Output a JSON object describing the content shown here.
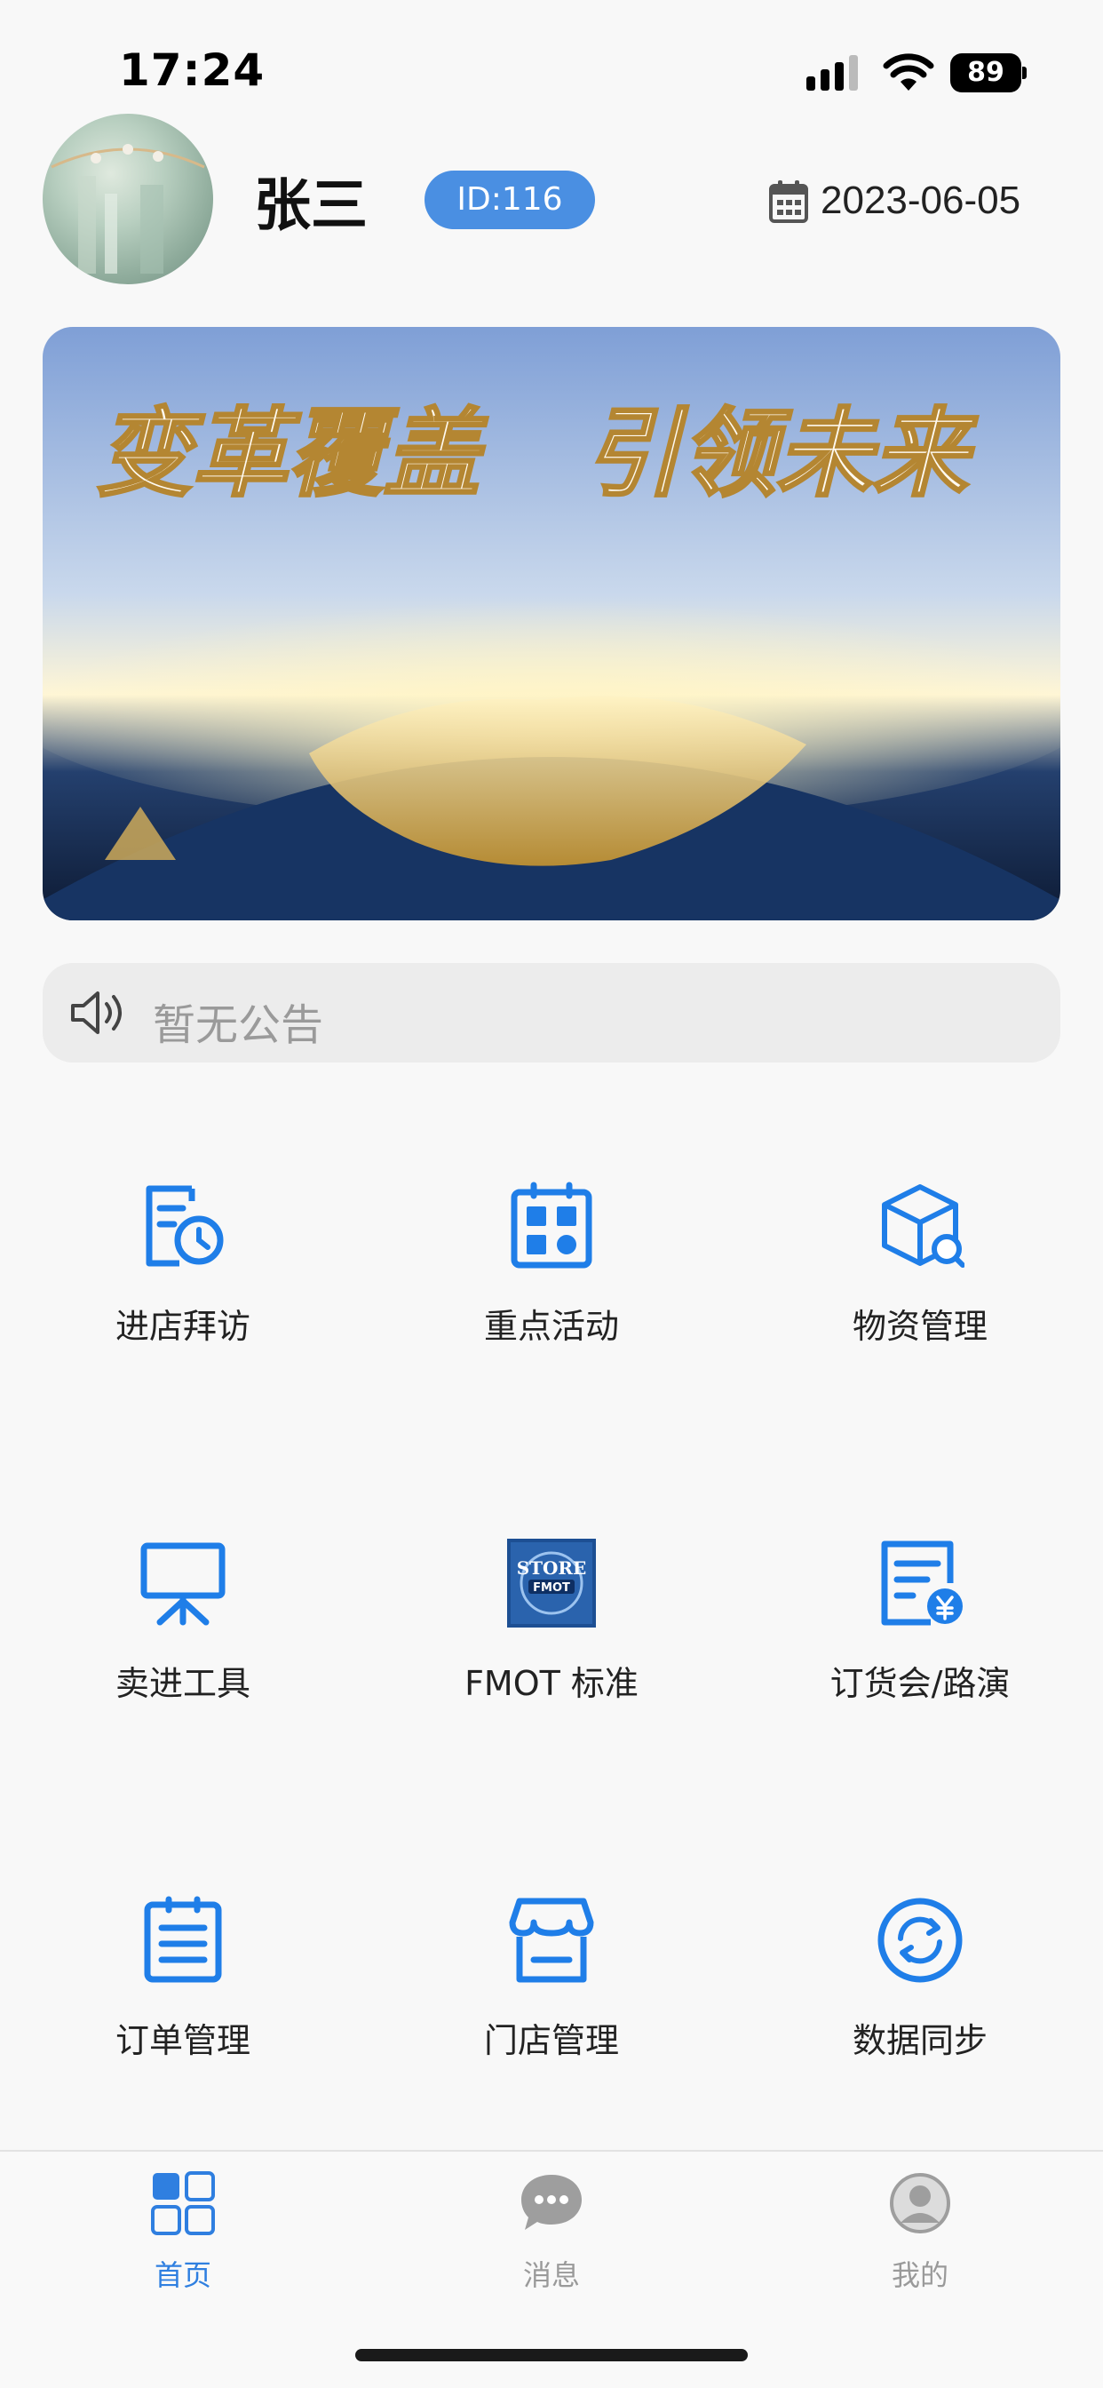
{
  "status_bar": {
    "time": "17:24",
    "battery": "89"
  },
  "header": {
    "user_name": "张三",
    "user_id": "ID:116",
    "date": "2023-06-05"
  },
  "banner": {
    "slogan_left": "变革覆盖",
    "slogan_right": "引领未来"
  },
  "notice": {
    "text": "暂无公告"
  },
  "menu": {
    "items": [
      {
        "label": "进店拜访",
        "icon": "store-visit-icon"
      },
      {
        "label": "重点活动",
        "icon": "key-activity-icon"
      },
      {
        "label": "物资管理",
        "icon": "materials-box-icon"
      },
      {
        "label": "卖进工具",
        "icon": "presentation-board-icon"
      },
      {
        "label": "FMOT 标准",
        "icon": "fmot-store-logo"
      },
      {
        "label": "订货会/路演",
        "icon": "order-invoice-icon"
      },
      {
        "label": "订单管理",
        "icon": "clipboard-list-icon"
      },
      {
        "label": "门店管理",
        "icon": "storefront-icon"
      },
      {
        "label": "数据同步",
        "icon": "sync-icon"
      }
    ]
  },
  "tabbar": {
    "tabs": [
      {
        "label": "首页",
        "icon": "home-grid-icon",
        "active": true
      },
      {
        "label": "消息",
        "icon": "message-bubble-icon",
        "active": false
      },
      {
        "label": "我的",
        "icon": "profile-icon",
        "active": false
      }
    ]
  },
  "colors": {
    "accent": "#1f7ee8",
    "badge": "#4a8fe2",
    "inactive": "#9a9a9a"
  }
}
